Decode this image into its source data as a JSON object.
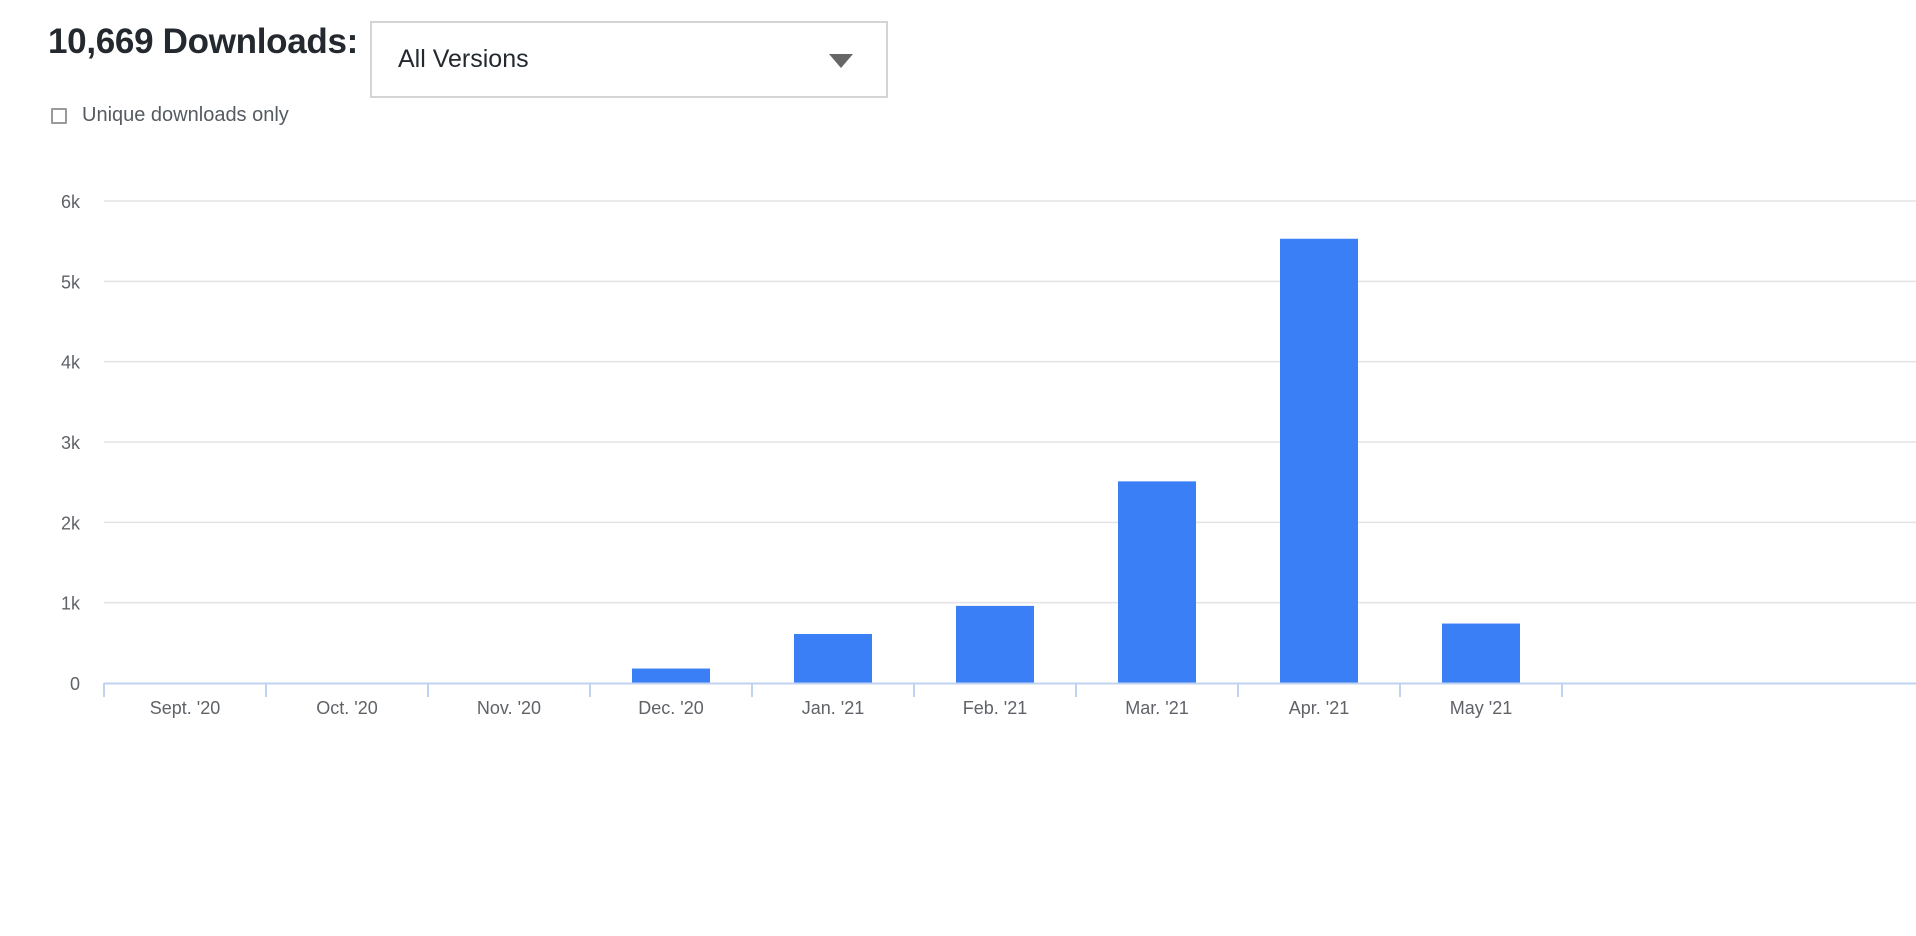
{
  "header": {
    "title": "10,669 Downloads:"
  },
  "version_select": {
    "value": "All Versions",
    "icon": "caret-down-icon"
  },
  "unique_toggle": {
    "label": "Unique downloads only",
    "checked": false
  },
  "colors": {
    "bar": "#3a7ff6",
    "grid": "#e1e3e6",
    "axis": "#bfd3f0",
    "tick_text": "#5f6368"
  },
  "chart_data": {
    "type": "bar",
    "title": "",
    "xlabel": "",
    "ylabel": "",
    "categories": [
      "Sept. '20",
      "Oct. '20",
      "Nov. '20",
      "Dec. '20",
      "Jan. '21",
      "Feb. '21",
      "Mar. '21",
      "Apr. '21",
      "May '21"
    ],
    "values": [
      0,
      0,
      0,
      180,
      610,
      960,
      2510,
      5530,
      740
    ],
    "ylim": [
      0,
      6000
    ],
    "yticks": [
      0,
      1000,
      2000,
      3000,
      4000,
      5000,
      6000
    ],
    "ytick_labels": [
      "0",
      "1k",
      "2k",
      "3k",
      "4k",
      "5k",
      "6k"
    ],
    "grid": true,
    "legend": "none"
  }
}
